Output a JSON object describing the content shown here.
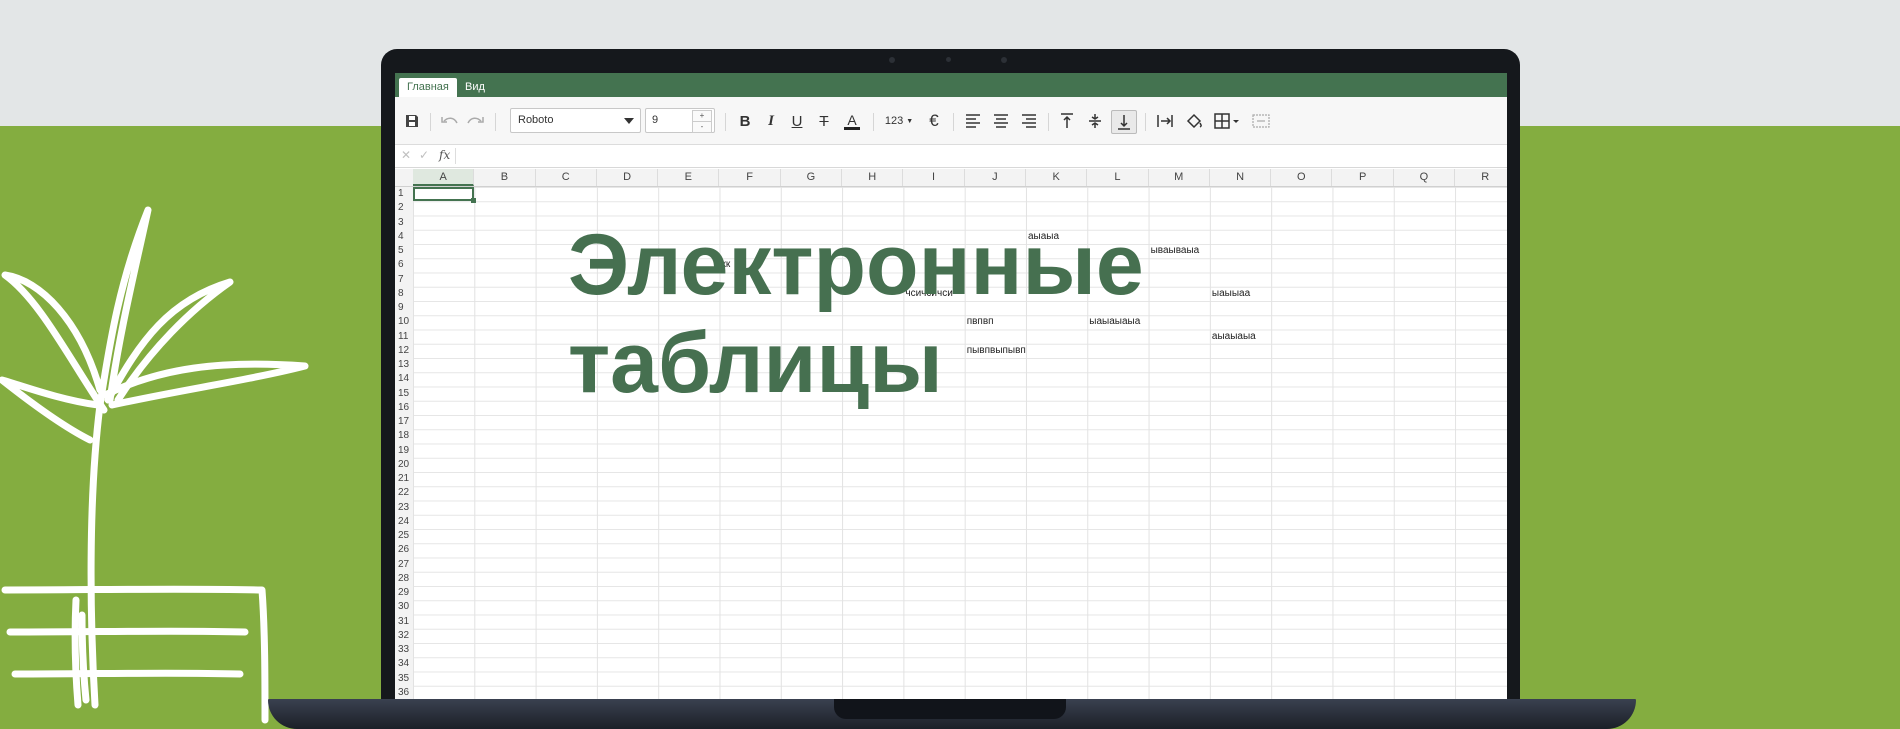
{
  "headline": {
    "line1": "Электронные",
    "line2": "таблицы"
  },
  "app": {
    "tabs": [
      "Главная",
      "Вид"
    ],
    "active_tab": "Главная",
    "toolbar": {
      "font_family": "Roboto",
      "font_size": "9",
      "number_format_label": "123",
      "currency_symbol": "€",
      "size_up": "+",
      "size_down": "-"
    },
    "formula_bar": {
      "fx_label": "fx",
      "cancel": "✕",
      "confirm": "✓",
      "value": ""
    },
    "columns": [
      "A",
      "B",
      "C",
      "D",
      "E",
      "F",
      "G",
      "H",
      "I",
      "J",
      "K",
      "L",
      "M",
      "N",
      "O",
      "P",
      "Q",
      "R"
    ],
    "selected_column": "A",
    "rows": [
      "1",
      "2",
      "3",
      "4",
      "5",
      "6",
      "7",
      "8",
      "9",
      "10",
      "11",
      "12",
      "13",
      "14",
      "15",
      "16",
      "17",
      "18",
      "19",
      "20",
      "21",
      "22",
      "23",
      "24",
      "25",
      "26",
      "27",
      "28",
      "29",
      "30",
      "31",
      "32",
      "33",
      "34",
      "35",
      "36"
    ],
    "active_cell": "A1",
    "cells": [
      {
        "ref": "K4",
        "value": "аыаыа"
      },
      {
        "ref": "M5",
        "value": "ываываыа"
      },
      {
        "ref": "F6",
        "value": "кк"
      },
      {
        "ref": "I8",
        "value": "чсичсичси"
      },
      {
        "ref": "N8",
        "value": "ыаыыаа"
      },
      {
        "ref": "J10",
        "value": "пвпвп"
      },
      {
        "ref": "L10",
        "value": "ыаыаыаыа"
      },
      {
        "ref": "N11",
        "value": "аыаыаыа"
      },
      {
        "ref": "J12",
        "value": "пывпвыпывп"
      }
    ]
  },
  "colors": {
    "background": "#84ad40",
    "top_band": "#e3e6e7",
    "accent": "#447350",
    "headline": "#467050"
  }
}
